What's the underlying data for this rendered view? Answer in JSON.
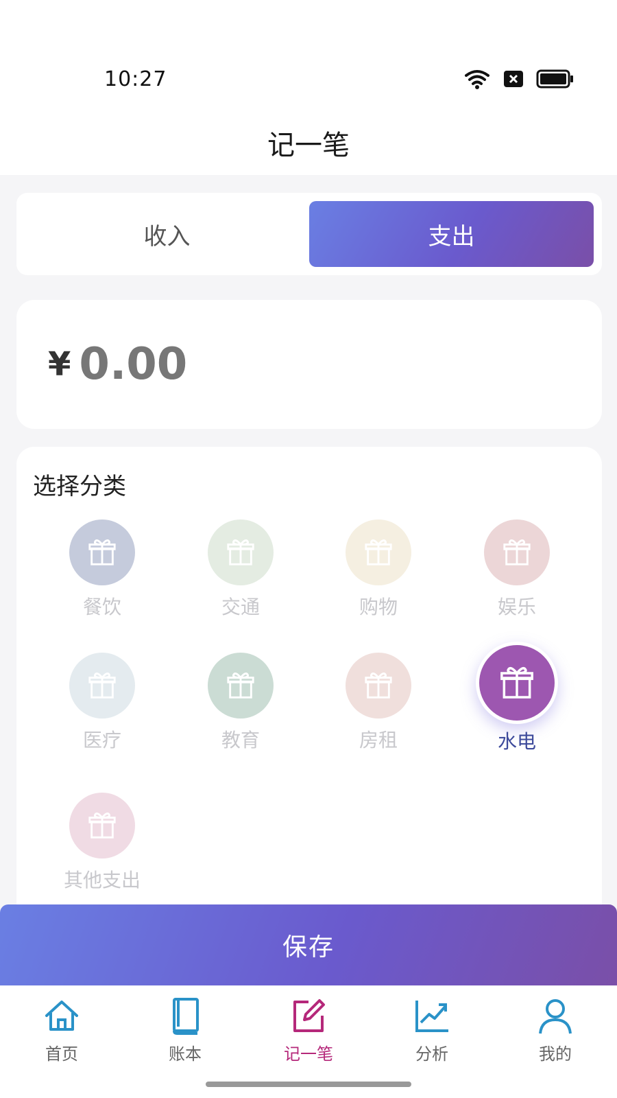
{
  "status": {
    "time": "10:27"
  },
  "header": {
    "title": "记一笔"
  },
  "type_toggle": {
    "income_label": "收入",
    "expense_label": "支出",
    "selected": "支出"
  },
  "amount": {
    "symbol": "¥",
    "value": "0.00"
  },
  "category": {
    "title": "选择分类",
    "selected": "水电",
    "items": [
      {
        "label": "餐饮",
        "color": "#c5cbdc"
      },
      {
        "label": "交通",
        "color": "#e4ece2"
      },
      {
        "label": "购物",
        "color": "#f5efe1"
      },
      {
        "label": "娱乐",
        "color": "#ecd6d7"
      },
      {
        "label": "医疗",
        "color": "#e4ebef"
      },
      {
        "label": "教育",
        "color": "#cbdcd4"
      },
      {
        "label": "房租",
        "color": "#f0dfdc"
      },
      {
        "label": "水电",
        "color": "#9d57b0"
      },
      {
        "label": "其他支出",
        "color": "#f0dbe4"
      }
    ]
  },
  "save": {
    "label": "保存"
  },
  "tabs": [
    {
      "label": "首页",
      "icon": "home-icon"
    },
    {
      "label": "账本",
      "icon": "book-icon"
    },
    {
      "label": "记一笔",
      "icon": "edit-icon"
    },
    {
      "label": "分析",
      "icon": "chart-icon"
    },
    {
      "label": "我的",
      "icon": "user-icon"
    }
  ],
  "colors": {
    "accent_start": "#6a7fe3",
    "accent_end": "#7a4fa8",
    "active_tab": "#b5287a",
    "tab_icon": "#2a92c8"
  }
}
